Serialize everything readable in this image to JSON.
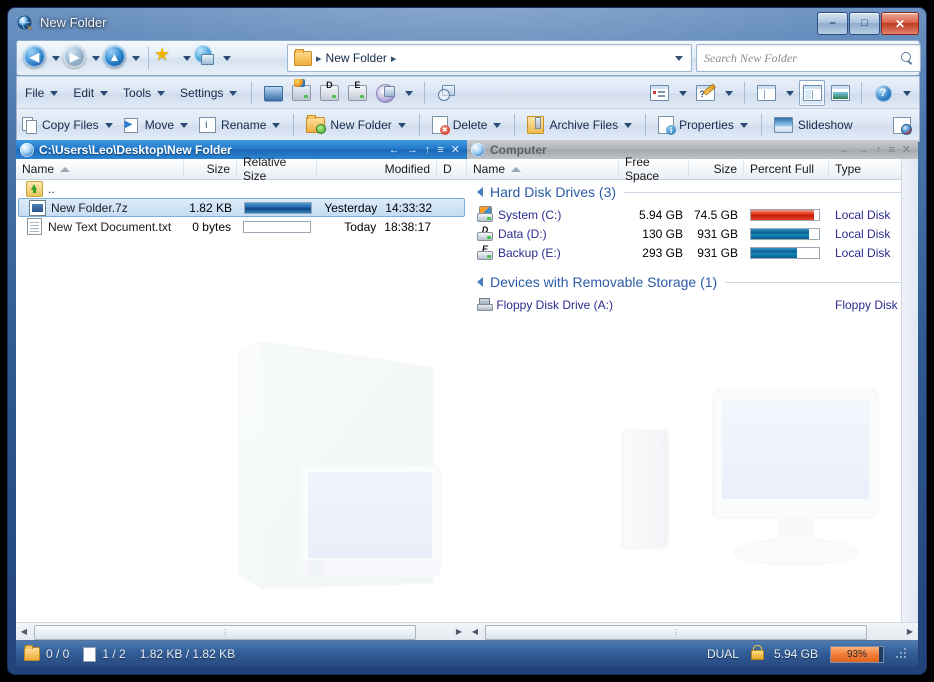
{
  "window": {
    "title": "New Folder",
    "icon": "app-globe-icon",
    "controls": {
      "minimize": "–",
      "restore": "□",
      "close": "✕"
    }
  },
  "navbar": {
    "back": {
      "name": "back-button",
      "glyph": "◀"
    },
    "forward": {
      "name": "forward-button",
      "glyph": "▶"
    },
    "up": {
      "name": "up-button",
      "glyph": "▲"
    },
    "favorites": {
      "name": "favorites-button",
      "glyph": "★"
    },
    "network": {
      "name": "network-button"
    },
    "address": {
      "crumb": "New Folder",
      "sep": "▸"
    },
    "search": {
      "placeholder": "Search New Folder"
    }
  },
  "menubar": {
    "items": [
      {
        "label": "File"
      },
      {
        "label": "Edit"
      },
      {
        "label": "Tools"
      },
      {
        "label": "Settings"
      }
    ],
    "quick_icons": [
      {
        "name": "desktop-icon"
      },
      {
        "name": "system-drive-icon"
      },
      {
        "name": "drive-d-icon",
        "letter": "D"
      },
      {
        "name": "drive-e-icon",
        "letter": "E"
      },
      {
        "name": "optical-drive-icon"
      },
      {
        "name": "find-files-icon"
      }
    ],
    "right_icons": [
      {
        "name": "list-view-icon"
      },
      {
        "name": "edit-notes-icon"
      },
      {
        "name": "single-pane-icon"
      },
      {
        "name": "dual-pane-icon"
      },
      {
        "name": "preview-pane-icon"
      },
      {
        "name": "help-icon",
        "glyph": "?"
      }
    ]
  },
  "commandbar": {
    "buttons": [
      {
        "label": "Copy Files",
        "icon": "copy-files-icon",
        "dropdown": true
      },
      {
        "label": "Move",
        "icon": "move-icon",
        "dropdown": true
      },
      {
        "label": "Rename",
        "icon": "rename-icon",
        "dropdown": true
      },
      {
        "label": "New Folder",
        "icon": "new-folder-icon",
        "dropdown": true
      },
      {
        "label": "Delete",
        "icon": "delete-icon",
        "dropdown": true
      },
      {
        "label": "Archive Files",
        "icon": "archive-files-icon",
        "dropdown": true
      },
      {
        "label": "Properties",
        "icon": "properties-icon",
        "dropdown": true
      },
      {
        "label": "Slideshow",
        "icon": "slideshow-icon",
        "dropdown": false
      }
    ],
    "end_icon": "configure-icon"
  },
  "left_pane": {
    "title": "C:\\Users\\Leo\\Desktop\\New Folder",
    "active": true,
    "controls": [
      "←",
      "→",
      "↑",
      "≡",
      "✕"
    ],
    "columns": [
      {
        "label": "Name",
        "sorted": "asc"
      },
      {
        "label": "Size"
      },
      {
        "label": "Relative Size"
      },
      {
        "label": "Modified"
      },
      {
        "label": "D"
      }
    ],
    "rows": [
      {
        "icon": "parent-folder-icon",
        "name": "..",
        "size": "",
        "relative_pct": null,
        "modified_day": "",
        "modified_time": "",
        "selected": false
      },
      {
        "icon": "archive-7z-icon",
        "name": "New Folder.7z",
        "size": "1.82 KB",
        "relative_pct": 100,
        "modified_day": "Yesterday",
        "modified_time": "14:33:32",
        "selected": true
      },
      {
        "icon": "text-document-icon",
        "name": "New Text Document.txt",
        "size": "0 bytes",
        "relative_pct": 0,
        "modified_day": "Today",
        "modified_time": "18:38:17",
        "selected": false
      }
    ]
  },
  "right_pane": {
    "title": "Computer",
    "active": false,
    "controls": [
      "←",
      "→",
      "↑",
      "≡",
      "✕"
    ],
    "columns": [
      {
        "label": "Name",
        "sorted": "asc"
      },
      {
        "label": "Free Space"
      },
      {
        "label": "Size"
      },
      {
        "label": "Percent Full"
      },
      {
        "label": "Type"
      }
    ],
    "groups": [
      {
        "label": "Hard Disk Drives (3)",
        "expanded": true,
        "rows": [
          {
            "icon": "windows-drive-icon",
            "name": "System (C:)",
            "free_space": "5.94 GB",
            "size": "74.5 GB",
            "percent_full": 92,
            "bar_color": "red",
            "type": "Local Disk"
          },
          {
            "icon": "drive-d-icon",
            "letter": "D",
            "name": "Data (D:)",
            "free_space": "130 GB",
            "size": "931 GB",
            "percent_full": 86,
            "bar_color": "blue",
            "type": "Local Disk"
          },
          {
            "icon": "drive-e-icon",
            "letter": "E",
            "name": "Backup (E:)",
            "free_space": "293 GB",
            "size": "931 GB",
            "percent_full": 68,
            "bar_color": "blue",
            "type": "Local Disk"
          }
        ]
      },
      {
        "label": "Devices with Removable Storage (1)",
        "expanded": true,
        "rows": [
          {
            "icon": "floppy-drive-icon",
            "name": "Floppy Disk Drive (A:)",
            "free_space": "",
            "size": "",
            "percent_full": null,
            "bar_color": null,
            "type": "Floppy Disk Driv"
          }
        ]
      }
    ]
  },
  "statusbar": {
    "folders_count": "0 / 0",
    "files_count": "1 / 2",
    "size_summary": "1.82 KB / 1.82 KB",
    "mode": "DUAL",
    "lock_icon": "unlocked-padlock-icon",
    "free_space": "5.94 GB",
    "percent_label": "93%",
    "percent_value": 93
  },
  "colors": {
    "accent": "#2277c9",
    "title_active": "#1a67b4",
    "title_inactive": "#a3a8ae",
    "link": "#2b2b8f",
    "group_heading": "#2b5ba8",
    "bar_red": "#e02e14",
    "bar_blue": "#0e5f91",
    "status_orange": "#f07a33"
  }
}
